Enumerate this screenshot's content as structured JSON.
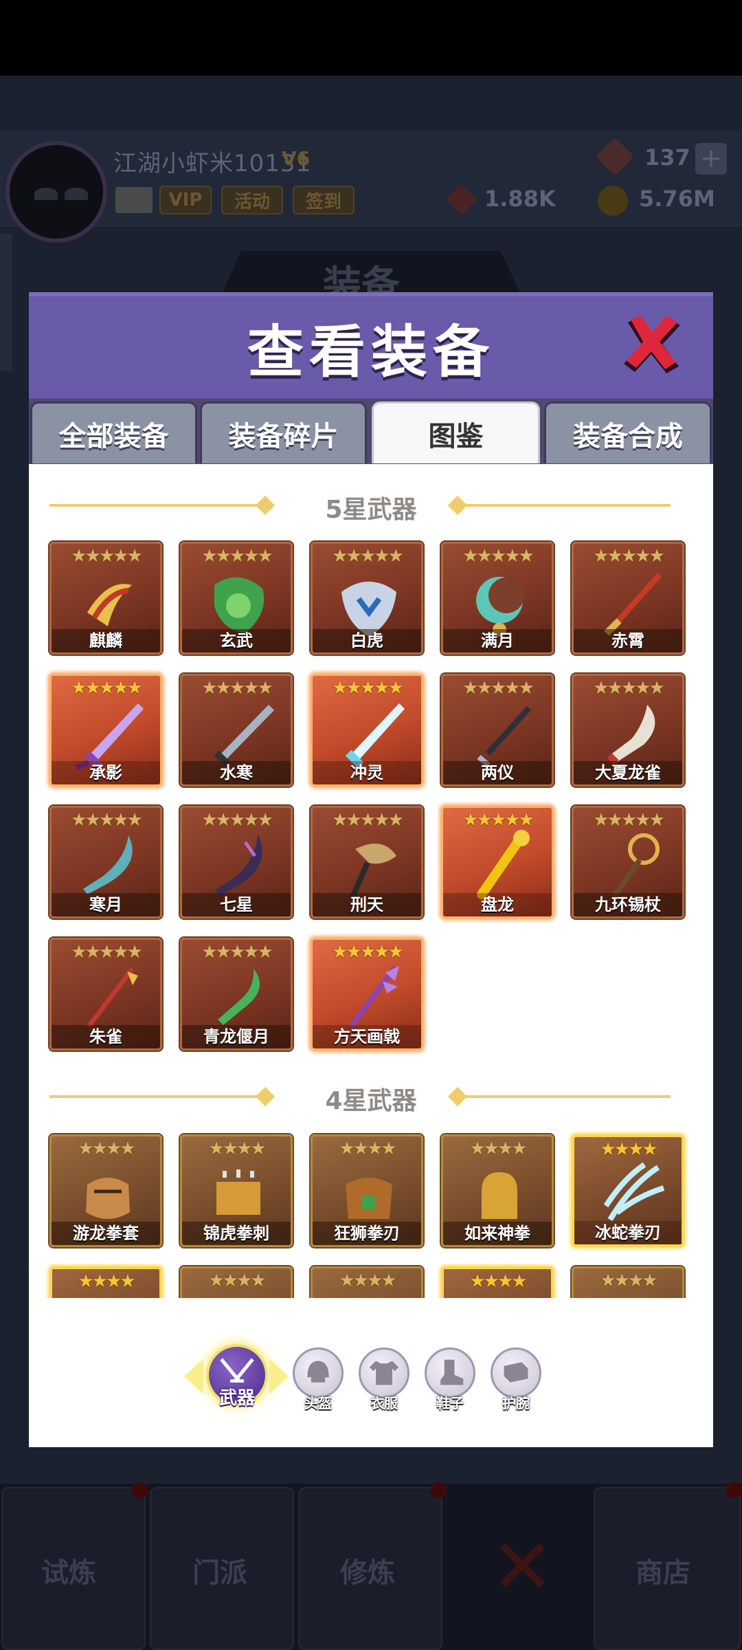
{
  "player": {
    "name": "江湖小虾米10131",
    "vip": "V6"
  },
  "top_buttons": {
    "vip": "VIP",
    "activity": "活动",
    "signin": "签到"
  },
  "currency": {
    "gems": "137",
    "power": "1.88K",
    "gold": "5.76M"
  },
  "background_title": "装备",
  "bottom_nav": [
    "试炼",
    "门派",
    "修炼",
    "",
    "商店"
  ],
  "dialog": {
    "title": "查看装备",
    "tabs": [
      "全部装备",
      "装备碎片",
      "图鉴",
      "装备合成"
    ],
    "active_tab": "图鉴"
  },
  "sections": {
    "five_star": {
      "title": "5星武器",
      "stars": "★★★★★",
      "items": [
        "麒麟",
        "玄武",
        "白虎",
        "满月",
        "赤霄",
        "承影",
        "水寒",
        "冲灵",
        "两仪",
        "大夏龙雀",
        "寒月",
        "七星",
        "刑天",
        "盘龙",
        "九环锡杖",
        "朱雀",
        "青龙偃月",
        "方天画戟"
      ]
    },
    "four_star": {
      "title": "4星武器",
      "stars": "★★★★",
      "items": [
        "游龙拳套",
        "锦虎拳刺",
        "狂狮拳刃",
        "如来神拳",
        "冰蛇拳刃"
      ]
    }
  },
  "categories": [
    "武器",
    "头盔",
    "衣服",
    "鞋子",
    "护腕"
  ],
  "colors": {
    "header": "#6a5aaa",
    "accent_gold": "#f0cd6a",
    "star": "#f8c53a"
  }
}
